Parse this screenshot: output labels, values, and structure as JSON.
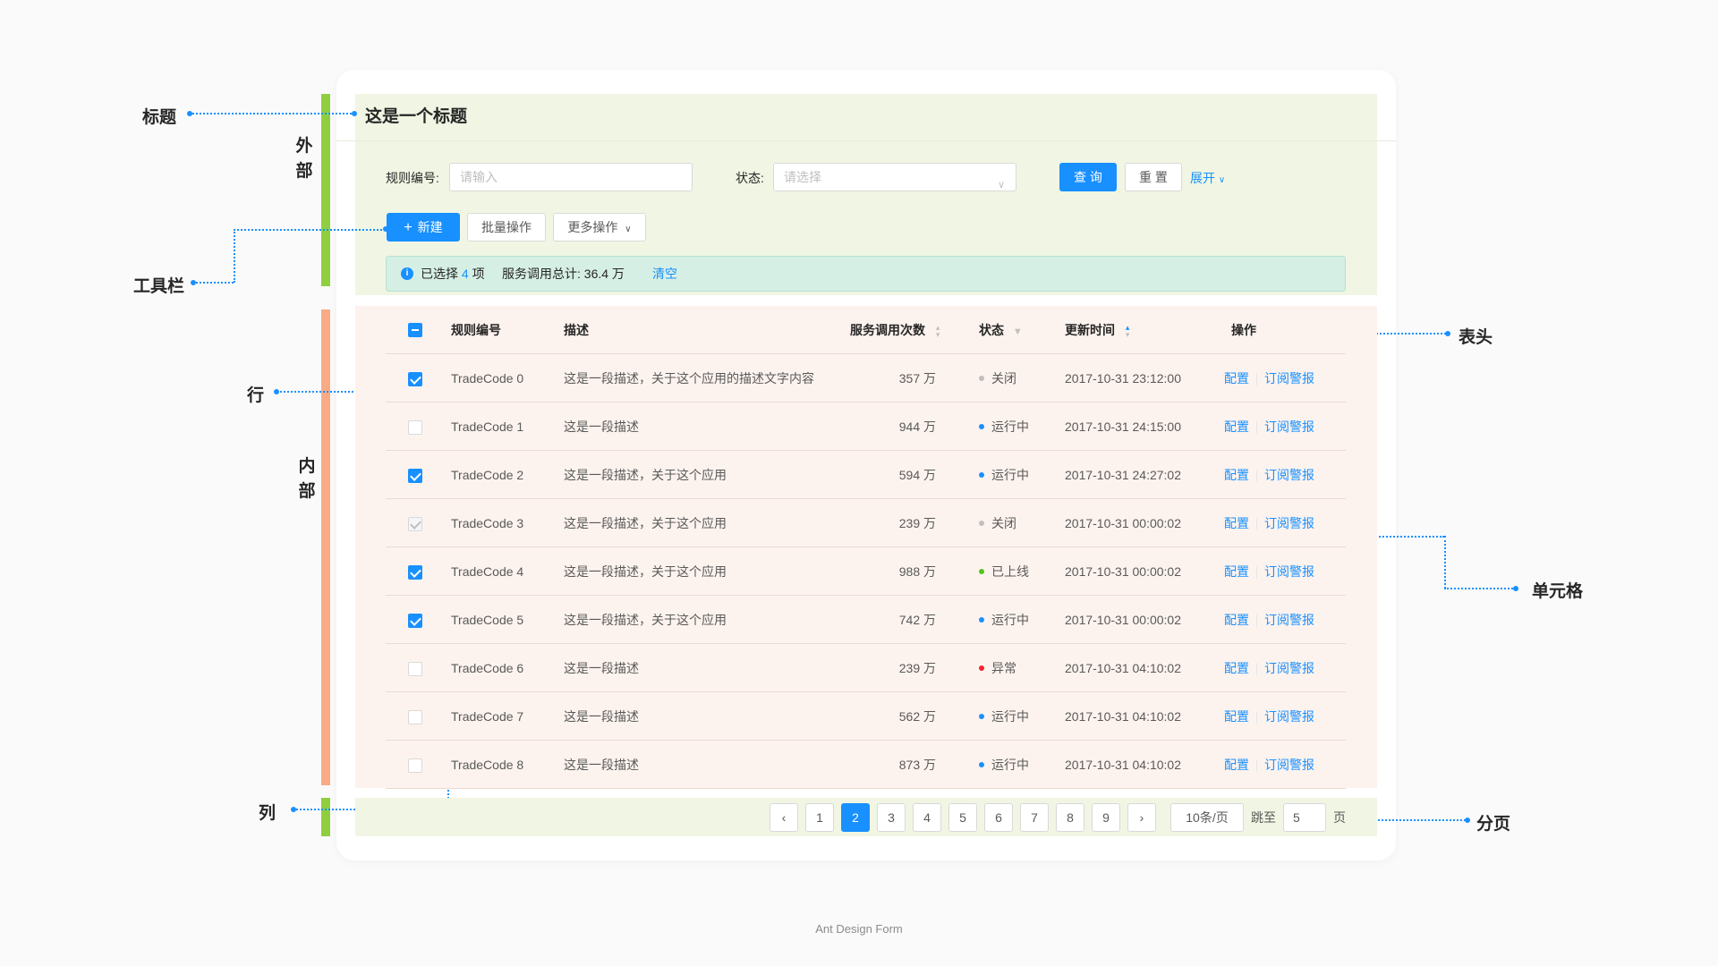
{
  "title": "这是一个标题",
  "annotations": {
    "title": "标题",
    "outer": "外部",
    "toolbar": "工具栏",
    "row": "行",
    "inner": "内部",
    "column": "列",
    "header": "表头",
    "cell": "单元格",
    "pagination": "分页"
  },
  "search": {
    "rule_label": "规则编号:",
    "rule_placeholder": "请输入",
    "status_label": "状态:",
    "status_placeholder": "请选择",
    "query": "查 询",
    "reset": "重 置",
    "expand": "展开"
  },
  "toolbar": {
    "new": "新建",
    "batch": "批量操作",
    "more": "更多操作"
  },
  "alert": {
    "selected_prefix": "已选择",
    "selected_count": "4",
    "selected_suffix": "项",
    "total_label": "服务调用总计:",
    "total_value": "36.4 万",
    "clear": "清空"
  },
  "table": {
    "columns": [
      "规则编号",
      "描述",
      "服务调用次数",
      "状态",
      "更新时间",
      "操作"
    ],
    "rows": [
      {
        "code": "TradeCode 0",
        "desc": "这是一段描述，关于这个应用的描述文字内容",
        "calls": "357 万",
        "status": "关闭",
        "status_color": "#bfbfbf",
        "time": "2017-10-31  23:12:00",
        "checked": "on"
      },
      {
        "code": "TradeCode 1",
        "desc": "这是一段描述",
        "calls": "944 万",
        "status": "运行中",
        "status_color": "#1890ff",
        "time": "2017-10-31  24:15:00",
        "checked": "off"
      },
      {
        "code": "TradeCode 2",
        "desc": "这是一段描述，关于这个应用",
        "calls": "594 万",
        "status": "运行中",
        "status_color": "#1890ff",
        "time": "2017-10-31  24:27:02",
        "checked": "on"
      },
      {
        "code": "TradeCode 3",
        "desc": "这是一段描述，关于这个应用",
        "calls": "239 万",
        "status": "关闭",
        "status_color": "#bfbfbf",
        "time": "2017-10-31  00:00:02",
        "checked": "dis"
      },
      {
        "code": "TradeCode 4",
        "desc": "这是一段描述，关于这个应用",
        "calls": "988 万",
        "status": "已上线",
        "status_color": "#52c41a",
        "time": "2017-10-31  00:00:02",
        "checked": "on"
      },
      {
        "code": "TradeCode 5",
        "desc": "这是一段描述，关于这个应用",
        "calls": "742 万",
        "status": "运行中",
        "status_color": "#1890ff",
        "time": "2017-10-31  00:00:02",
        "checked": "on"
      },
      {
        "code": "TradeCode 6",
        "desc": "这是一段描述",
        "calls": "239 万",
        "status": "异常",
        "status_color": "#f5222d",
        "time": "2017-10-31  04:10:02",
        "checked": "off"
      },
      {
        "code": "TradeCode 7",
        "desc": "这是一段描述",
        "calls": "562 万",
        "status": "运行中",
        "status_color": "#1890ff",
        "time": "2017-10-31  04:10:02",
        "checked": "off"
      },
      {
        "code": "TradeCode 8",
        "desc": "这是一段描述",
        "calls": "873 万",
        "status": "运行中",
        "status_color": "#1890ff",
        "time": "2017-10-31  04:10:02",
        "checked": "off"
      }
    ],
    "op_config": "配置",
    "op_subscribe": "订阅警报"
  },
  "pagination": {
    "pages": [
      "1",
      "2",
      "3",
      "4",
      "5",
      "6",
      "7",
      "8",
      "9"
    ],
    "current": "2",
    "prev_icon": "chevron-left-icon",
    "next_icon": "chevron-right-icon",
    "page_size": "10条/页",
    "jump_label": "跳至",
    "jump_value": "5",
    "page_unit": "页"
  },
  "footer": "Ant Design Form",
  "colors": {
    "primary": "#1890ff",
    "outer_bg": "#f0f6e3",
    "inner_bg": "#fdf3ee",
    "outer_bar": "#8fcf3f",
    "inner_bar": "#f9ab86"
  }
}
